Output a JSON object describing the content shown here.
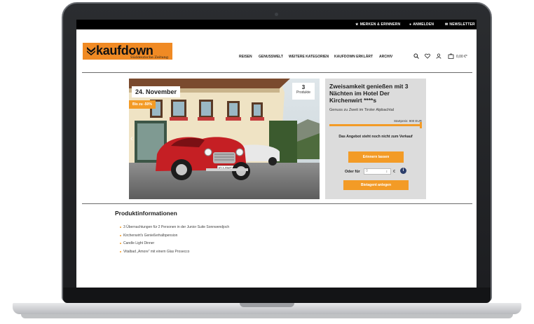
{
  "topbar": {
    "links": [
      {
        "label": "MERKEN & ERINNERN",
        "icon": "star-icon"
      },
      {
        "label": "ANMELDEN",
        "icon": "user-icon"
      },
      {
        "label": "NEWSLETTER",
        "icon": "envelope-icon"
      }
    ]
  },
  "header": {
    "logo_text": "kaufdown",
    "logo_sub": "Süddeutsche Zeitung",
    "nav": [
      "REISEN",
      "GENUSSWELT",
      "WEITERE KATEGORIEN",
      "KAUFDOWN ERKLÄRT",
      "ARCHIV"
    ],
    "icons": [
      "search-icon",
      "heart-icon",
      "user-icon",
      "cart-icon"
    ],
    "cart_total": "0,00 €*"
  },
  "hero": {
    "date": "24. November",
    "discount": "Bis zu -50%",
    "product_count": "3",
    "product_count_label": "Produkte"
  },
  "offer": {
    "title": "Zweisamkeit genießen mit 3 Nächten im Hotel Der Kirchenwirt ****s",
    "subtitle": "Genuss zu Zweit im Tiroler Alpbachtal",
    "start_price": "Startpreis: 900 EUR",
    "progress_fraction": 1.0,
    "note": "Das Angebot steht noch nicht zum Verkauf",
    "remind_button": "Erinnern lassen",
    "bid_label": "Oder für",
    "bid_placeholder": "0",
    "bid_currency": "€",
    "bid_button": "Bietagent anlegen"
  },
  "product_info": {
    "title": "Produktinformationen",
    "items": [
      "3 Übernachtungen für 2 Personen in der Junior Suite Sonnwendjoch",
      "Kirchenwirt's Genießerhalbpension",
      "Candle Light Dinner",
      "Vitalbad „Amore“ mit einem Glas Prosecco"
    ]
  },
  "colors": {
    "accent": "#f39b26",
    "topbar": "#000000",
    "panel": "#dcdcdc"
  }
}
